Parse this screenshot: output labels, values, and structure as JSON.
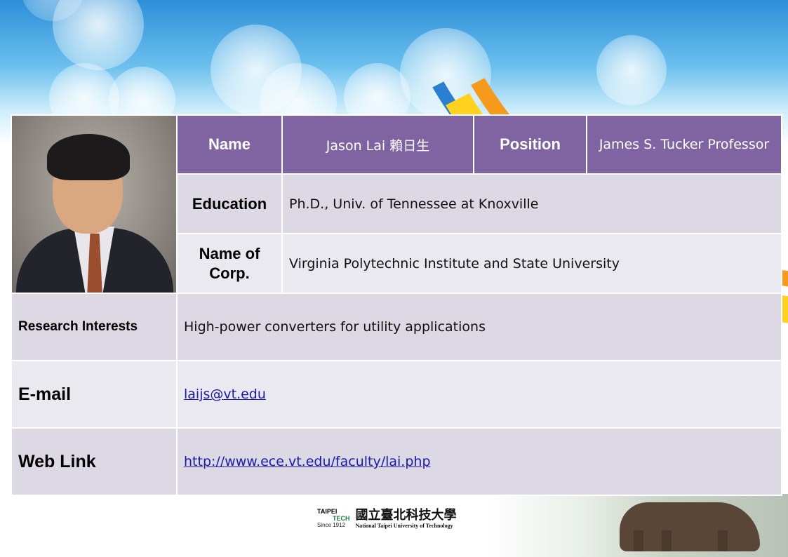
{
  "profile": {
    "name_label": "Name",
    "name_value": "Jason Lai  賴日生",
    "position_label": "Position",
    "position_value": "James S. Tucker Professor",
    "education_label": "Education",
    "education_value": "Ph.D., Univ. of Tennessee at Knoxville",
    "corp_label": "Name of Corp.",
    "corp_value": "Virginia Polytechnic Institute and State University",
    "research_label": "Research Interests",
    "research_value": "High-power converters for utility applications",
    "email_label": "E-mail",
    "email_value": "laijs@vt.edu",
    "web_label": "Web Link",
    "web_value": "http://www.ece.vt.edu/faculty/lai.php"
  },
  "footer": {
    "logo_line1": "TAIPEI",
    "logo_line2": "TECH",
    "since": "Since 1912",
    "university_zh": "國立臺北科技大學",
    "university_en": "National Taipei University of Technology"
  },
  "colors": {
    "header_purple": "#8064a2",
    "row_dark": "#dcd8e4",
    "row_light": "#ebe9f0",
    "link": "#1a1aa6"
  }
}
